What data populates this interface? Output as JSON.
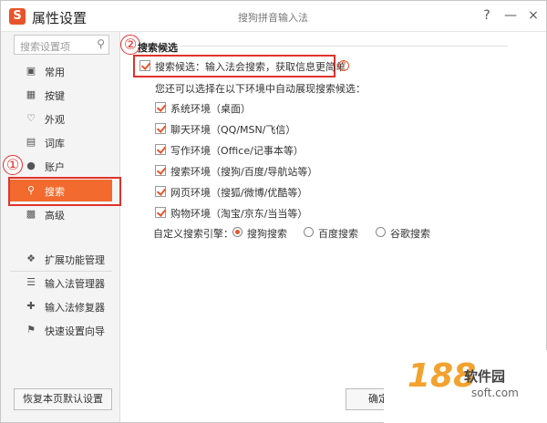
{
  "window": {
    "title": "属性设置",
    "center_title": "搜狗拼音输入法",
    "logo_letter": "S",
    "help_btn": "?",
    "minimize_btn": "—",
    "close_btn": "×"
  },
  "sidebar": {
    "search_placeholder": "搜索设置项",
    "items": [
      {
        "label": "常用",
        "icon": "monitor-icon"
      },
      {
        "label": "按键",
        "icon": "keyboard-icon"
      },
      {
        "label": "外观",
        "icon": "shirt-icon"
      },
      {
        "label": "词库",
        "icon": "book-icon"
      },
      {
        "label": "账户",
        "icon": "user-icon"
      },
      {
        "label": "搜索",
        "icon": "search-icon"
      },
      {
        "label": "高级",
        "icon": "advanced-icon"
      }
    ],
    "tools": [
      {
        "label": "扩展功能管理",
        "icon": "puzzle-icon"
      },
      {
        "label": "输入法管理器",
        "icon": "list-icon"
      },
      {
        "label": "输入法修复器",
        "icon": "repair-icon"
      },
      {
        "label": "快速设置向导",
        "icon": "flag-icon"
      }
    ],
    "reset_button": "恢复本页默认设置"
  },
  "annotations": {
    "circle1": "①",
    "circle2": "②"
  },
  "main": {
    "section_title": "搜索候选",
    "main_checkbox": "搜索候选：输入法会搜索，获取信息更简单",
    "help_icon": "?",
    "hint": "您还可以选择在以下环境中自动展现搜索候选：",
    "environments": [
      "系统环境（桌面）",
      "聊天环境（QQ/MSN/飞信）",
      "写作环境（Office/记事本等）",
      "搜索环境（搜狗/百度/导航站等）",
      "网页环境（搜狐/微博/优酷等）",
      "购物环境（淘宝/京东/当当等）"
    ],
    "engine_label": "自定义搜索引擎：",
    "engines": [
      "搜狗搜索",
      "百度搜索",
      "谷歌搜索"
    ],
    "selected_engine": "搜狗搜索",
    "ok_button": "确定"
  },
  "watermark": {
    "number": "188",
    "text": "软件园",
    "url": "soft.com"
  },
  "colors": {
    "accent": "#f26a2e",
    "annotation_red": "#e0322d"
  }
}
